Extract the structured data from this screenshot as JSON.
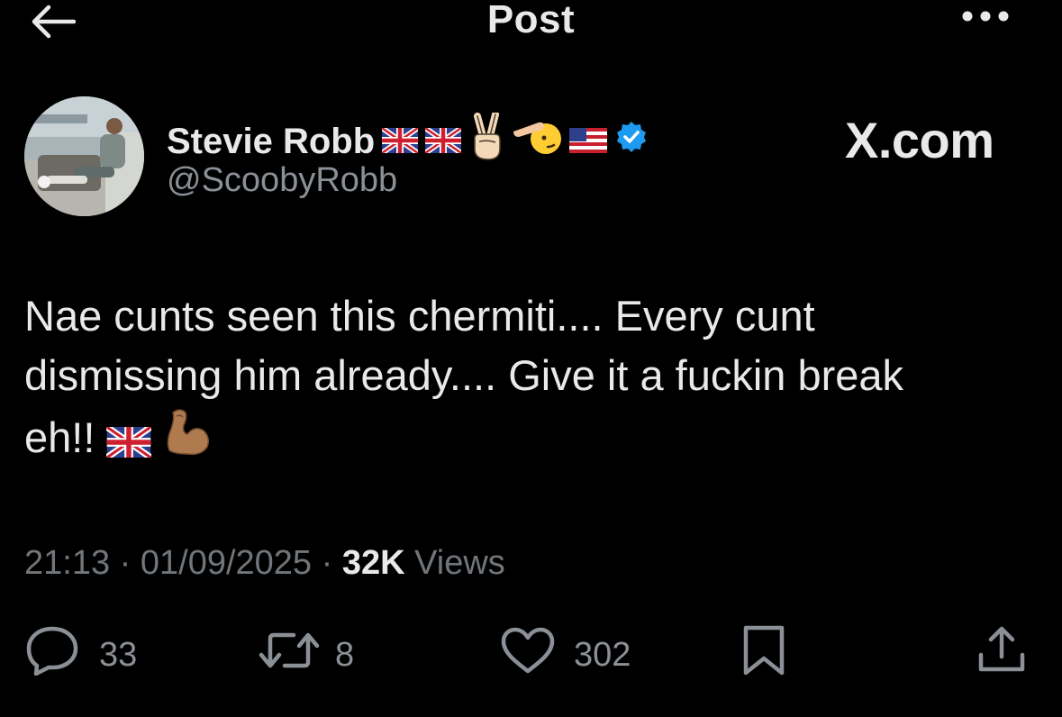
{
  "header": {
    "title": "Post",
    "back_icon": "arrow-left-icon",
    "more_icon": "more-horizontal-icon"
  },
  "author": {
    "display_name": "Stevie Robb",
    "handle": "@ScoobyRobb",
    "name_emojis": [
      "uk-flag",
      "uk-flag",
      "victory-hand",
      "saluting-face",
      "us-flag"
    ],
    "verified": true,
    "verified_color": "#1d9bf0"
  },
  "source_label": "X.com",
  "post": {
    "line1": "Nae cunts seen this chermiti.... Every cunt",
    "line2": "dismissing him already.... Give it a fuckin break",
    "line3": "eh!! ",
    "trailing_emojis": [
      "uk-flag",
      "flexed-biceps"
    ]
  },
  "meta": {
    "time": "21:13",
    "separator": " · ",
    "date": "01/09/2025",
    "views_count": "32K",
    "views_label": "Views"
  },
  "actions": {
    "replies": "33",
    "reposts": "8",
    "likes": "302"
  },
  "colors": {
    "background": "#000000",
    "primary_text": "#e7e9ea",
    "secondary_text": "#71767b"
  }
}
